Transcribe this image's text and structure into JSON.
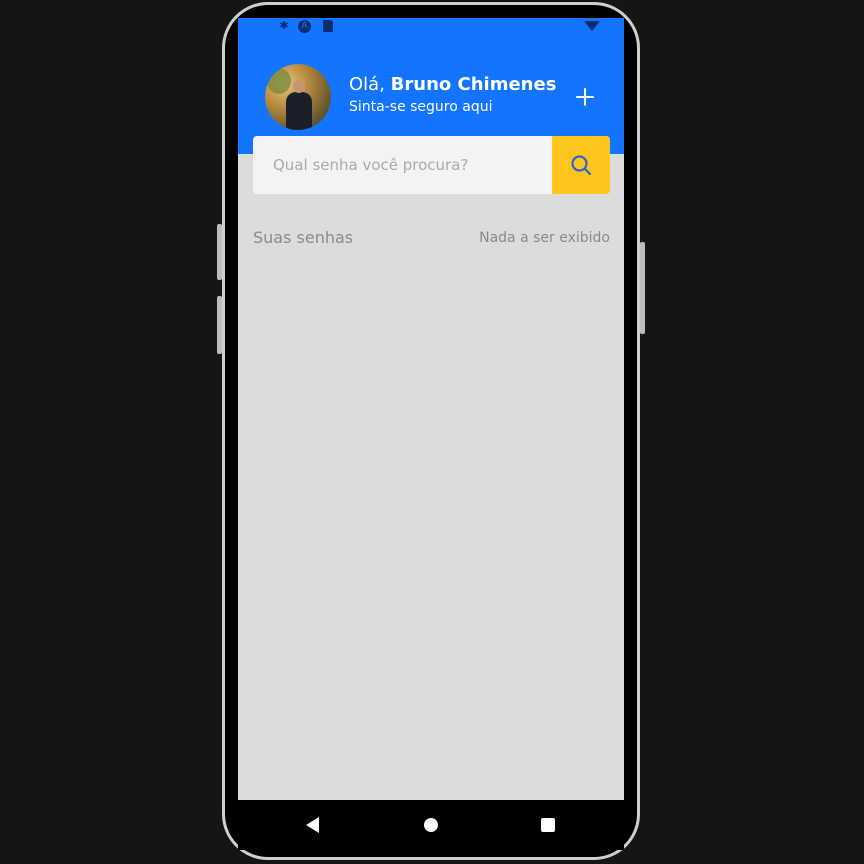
{
  "header": {
    "greeting_prefix": "Olá,",
    "user_name": "Bruno Chimenes",
    "subtitle": "Sinta-se seguro aqui",
    "add_icon": "plus-icon",
    "background_color": "#1274ff"
  },
  "search": {
    "placeholder": "Qual senha você procura?",
    "value": "",
    "button_icon": "search-icon",
    "button_color": "#ffc51c"
  },
  "passwords": {
    "section_title": "Suas senhas",
    "empty_message": "Nada a ser exibido",
    "items": []
  },
  "status_bar": {
    "icons": [
      "settings-icon",
      "android-icon",
      "sim-card-icon",
      "wifi-icon"
    ]
  },
  "navigation_bar": {
    "icons": [
      "back-icon",
      "home-icon",
      "recents-icon"
    ]
  }
}
